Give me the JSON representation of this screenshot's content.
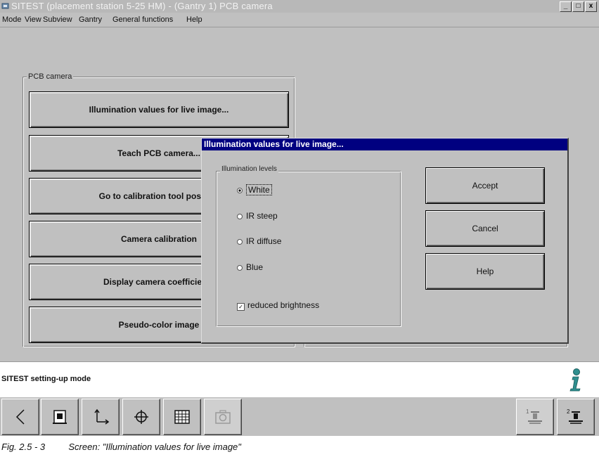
{
  "window": {
    "title": "SITEST (placement station 5-25 HM) - (Gantry 1) PCB camera",
    "controls": [
      "_",
      "□",
      "x"
    ]
  },
  "menu": {
    "items": [
      "Mode",
      "View",
      "Subview",
      "Gantry",
      "General functions",
      "Help"
    ]
  },
  "pcb_camera": {
    "group_label": "PCB camera",
    "buttons": [
      "Illumination values for live image...",
      "Teach PCB camera...",
      "Go to calibration tool position",
      "Camera calibration",
      "Display camera coefficients",
      "Pseudo-color image"
    ]
  },
  "dialog": {
    "title": "Illumination values for live image...",
    "group_label": "Illumination levels",
    "options": [
      {
        "label": "White",
        "selected": true
      },
      {
        "label": "IR steep",
        "selected": false
      },
      {
        "label": "IR diffuse",
        "selected": false
      },
      {
        "label": "Blue",
        "selected": false
      }
    ],
    "checkbox": {
      "label": "reduced brightness",
      "checked": true
    },
    "buttons": {
      "accept": "Accept",
      "cancel": "Cancel",
      "help": "Help"
    }
  },
  "status": {
    "text": "SITEST setting-up mode",
    "info_icon": "info-icon"
  },
  "toolbar": {
    "icons": [
      "back-arrow-icon",
      "feeder-icon",
      "axis-icon",
      "crosshair-icon",
      "grid-icon",
      "camera-icon"
    ],
    "gantry_labels": [
      "1",
      "2"
    ]
  },
  "caption": {
    "figure": "Fig. 2.5 - 3",
    "text": "Screen: \"Illumination values for live image\""
  }
}
